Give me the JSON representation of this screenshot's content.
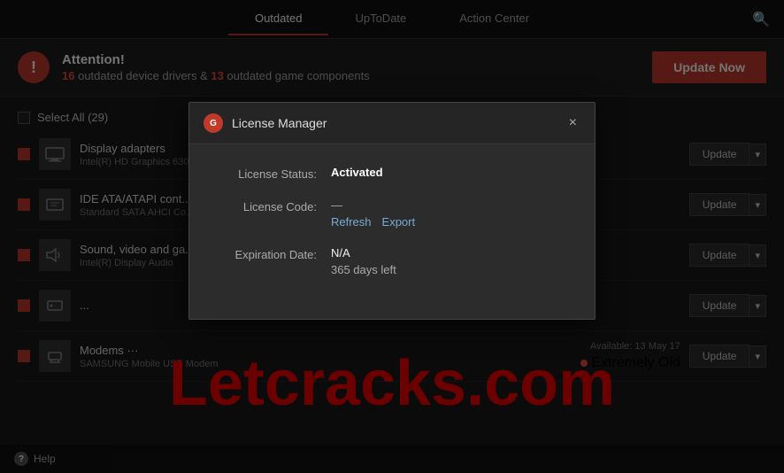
{
  "nav": {
    "tabs": [
      {
        "label": "Outdated",
        "active": true
      },
      {
        "label": "UpToDate",
        "active": false
      },
      {
        "label": "Action Center",
        "active": false
      }
    ]
  },
  "attention": {
    "title": "Attention!",
    "outdated_drivers": "16",
    "outdated_components": "13",
    "desc_text": "outdated device drivers &",
    "desc_text2": "outdated game components",
    "update_btn": "Update Now"
  },
  "select_all": "Select All (29)",
  "drivers": [
    {
      "name": "Display adapters",
      "sub": "Intel(R) HD Graphics 630",
      "status": "",
      "badge": ""
    },
    {
      "name": "IDE ATA/ATAPI cont...",
      "sub": "Standard SATA AHCI Co...",
      "status": "",
      "badge": ""
    },
    {
      "name": "Sound, video and ga...",
      "sub": "Intel(R) Display Audio",
      "status": "",
      "badge": ""
    },
    {
      "name": "...",
      "sub": "...",
      "status": "",
      "badge": ""
    },
    {
      "name": "Modems ···",
      "sub": "SAMSUNG Mobile USB Modem",
      "status": "Available: 13 May 17",
      "badge": "Extremely Old"
    }
  ],
  "update_btn_label": "Update",
  "watermark": "Letcracks.com",
  "help": {
    "label": "Help"
  },
  "dialog": {
    "title": "License Manager",
    "logo_letter": "G",
    "rows": [
      {
        "label": "License Status:",
        "value": "Activated",
        "type": "activated"
      },
      {
        "label": "License Code:",
        "dashes": "—",
        "refresh": "Refresh",
        "export": "Export",
        "type": "code"
      },
      {
        "label": "Expiration Date:",
        "value": "N/A",
        "days_left": "365 days left",
        "type": "expiry"
      }
    ],
    "close_label": "×"
  }
}
